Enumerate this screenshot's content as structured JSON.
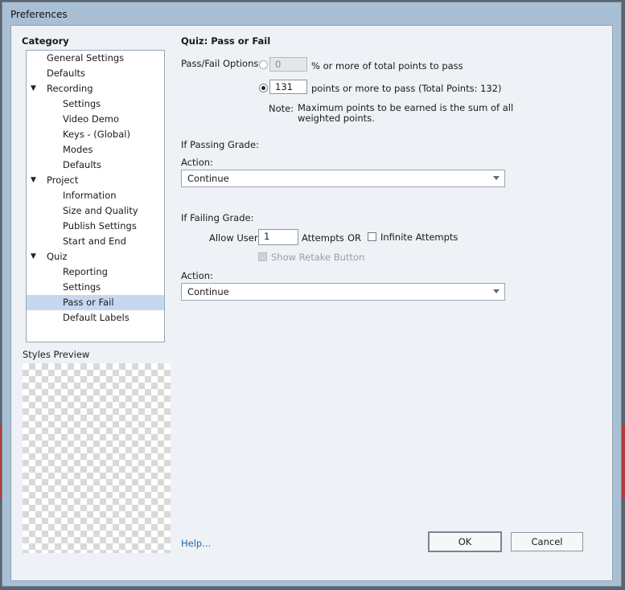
{
  "window": {
    "title": "Preferences"
  },
  "category": {
    "heading": "Category",
    "items": [
      {
        "label": "General Settings",
        "level": 0
      },
      {
        "label": "Defaults",
        "level": 0
      },
      {
        "label": "Recording",
        "level": 0,
        "expanded": true
      },
      {
        "label": "Settings",
        "level": 1
      },
      {
        "label": "Video Demo",
        "level": 1
      },
      {
        "label": "Keys - (Global)",
        "level": 1
      },
      {
        "label": "Modes",
        "level": 1
      },
      {
        "label": "Defaults",
        "level": 1
      },
      {
        "label": "Project",
        "level": 0,
        "expanded": true
      },
      {
        "label": "Information",
        "level": 1
      },
      {
        "label": "Size and Quality",
        "level": 1
      },
      {
        "label": "Publish Settings",
        "level": 1
      },
      {
        "label": "Start and End",
        "level": 1
      },
      {
        "label": "Quiz",
        "level": 0,
        "expanded": true
      },
      {
        "label": "Reporting",
        "level": 1
      },
      {
        "label": "Settings",
        "level": 1
      },
      {
        "label": "Pass or Fail",
        "level": 1,
        "selected": true
      },
      {
        "label": "Default Labels",
        "level": 1
      }
    ]
  },
  "styles_preview": {
    "label": "Styles Preview"
  },
  "help": {
    "label": "Help..."
  },
  "panel": {
    "title": "Quiz: Pass or Fail",
    "options_label": "Pass/Fail Options:",
    "percent_value": "0",
    "percent_text": "% or more of total points to pass",
    "points_value": "131",
    "points_text": "points or more to pass (Total Points: 132)",
    "note_label": "Note:",
    "note_line1": "Maximum points to be earned is the sum of all",
    "note_line2": "weighted points.",
    "passing_heading": "If Passing Grade:",
    "passing_action_label": "Action:",
    "passing_action_value": "Continue",
    "failing_heading": "If Failing Grade:",
    "allow_user_label": "Allow User:",
    "attempts_value": "1",
    "attempts_text": "Attempts",
    "or_text": "OR",
    "infinite_label": "Infinite Attempts",
    "retake_label": "Show Retake Button",
    "failing_action_label": "Action:",
    "failing_action_value": "Continue"
  },
  "buttons": {
    "ok": "OK",
    "cancel": "Cancel"
  }
}
